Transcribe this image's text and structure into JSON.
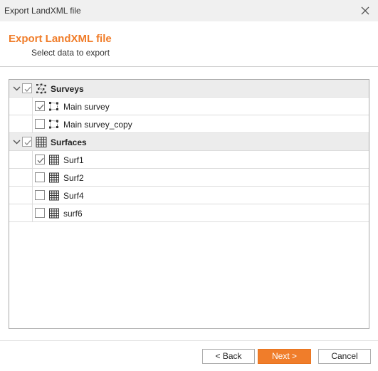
{
  "window": {
    "title": "Export LandXML file"
  },
  "header": {
    "title": "Export LandXML file",
    "subtitle": "Select data to export"
  },
  "tree": {
    "groups": [
      {
        "label": "Surveys",
        "icon": "survey-group-icon",
        "checked": true,
        "expanded": true,
        "items": [
          {
            "label": "Main survey",
            "icon": "survey-icon",
            "checked": true
          },
          {
            "label": "Main survey_copy",
            "icon": "survey-icon",
            "checked": false
          }
        ]
      },
      {
        "label": "Surfaces",
        "icon": "surface-grid-icon",
        "checked": true,
        "expanded": true,
        "items": [
          {
            "label": "Surf1",
            "icon": "surface-grid-icon",
            "checked": true
          },
          {
            "label": "Surf2",
            "icon": "surface-grid-icon",
            "checked": false
          },
          {
            "label": "Surf4",
            "icon": "surface-grid-icon",
            "checked": false
          },
          {
            "label": "surf6",
            "icon": "surface-grid-icon",
            "checked": false
          }
        ]
      }
    ]
  },
  "buttons": {
    "back": "< Back",
    "next": "Next >",
    "cancel": "Cancel"
  },
  "colors": {
    "accent": "#f07d2a",
    "group_row_bg": "#ececec",
    "border": "#a8a8a8"
  }
}
